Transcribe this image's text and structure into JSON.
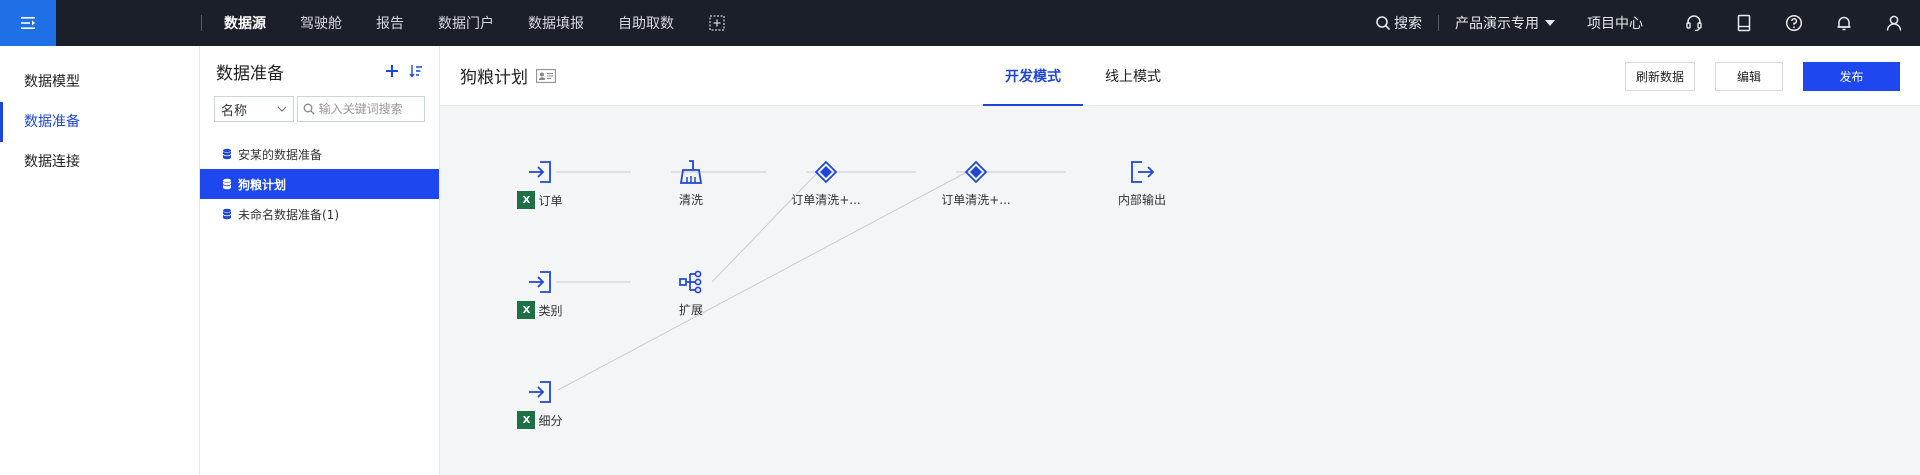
{
  "topbar": {
    "nav": [
      "数据源",
      "驾驶舱",
      "报告",
      "数据门户",
      "数据填报",
      "自助取数"
    ],
    "search_label": "搜索",
    "product_label": "产品演示专用",
    "project_center": "项目中心"
  },
  "sidebar": {
    "items": [
      "数据模型",
      "数据准备",
      "数据连接"
    ]
  },
  "panel": {
    "title": "数据准备",
    "filter_select": "名称",
    "search_placeholder": "输入关键词搜索",
    "items": [
      "安某的数据准备",
      "狗粮计划",
      "未命名数据准备(1)"
    ]
  },
  "main": {
    "title": "狗粮计划",
    "tabs": [
      "开发模式",
      "线上模式"
    ],
    "refresh_button": "刷新数据",
    "edit_button": "编辑",
    "publish_button": "发布"
  },
  "flow": {
    "nodes": {
      "order": "订单",
      "clean": "清洗",
      "join1": "订单清洗+...",
      "join2": "订单清洗+...",
      "output": "内部输出",
      "category": "类别",
      "expand": "扩展",
      "detail": "细分"
    },
    "excel_badge": "X"
  },
  "colors": {
    "topbar_bg": "#1b1f2a",
    "accent": "#1f47f0",
    "menu_btn": "#1f6fe6",
    "excel": "#1e7145"
  }
}
